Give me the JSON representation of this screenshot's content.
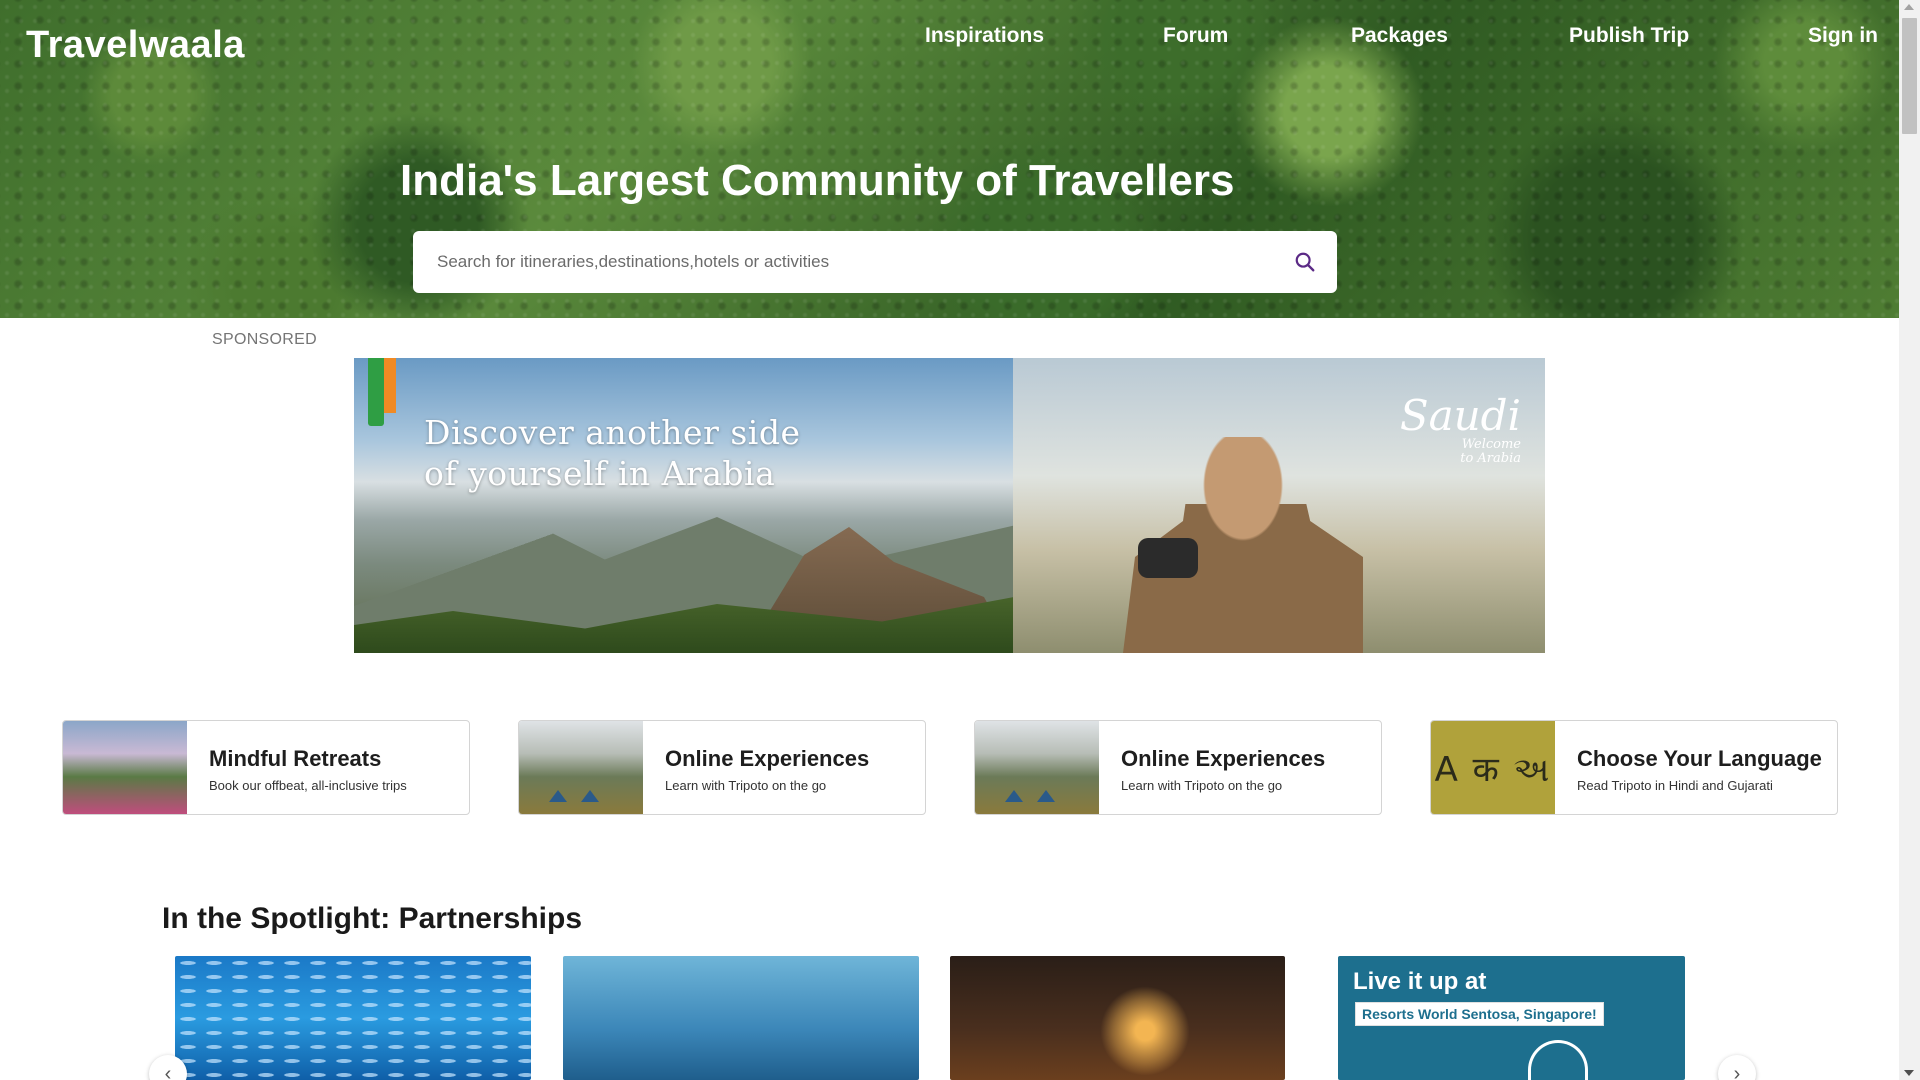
{
  "brand": {
    "name": "Travelwaala"
  },
  "nav": [
    {
      "label": "Inspirations"
    },
    {
      "label": "Forum"
    },
    {
      "label": "Packages"
    },
    {
      "label": "Publish Trip"
    },
    {
      "label": "Sign in"
    }
  ],
  "hero": {
    "title": "India's Largest Community of Travellers",
    "search_placeholder": "Search for itineraries,destinations,hotels or activities",
    "search_value": "",
    "search_icon": "search-icon",
    "search_icon_color": "#5b2a86"
  },
  "sponsored": {
    "label": "SPONSORED",
    "ad_headline_line1": "Discover another side",
    "ad_headline_line2": "of yourself in Arabia",
    "ad_logo_main": "Saudi",
    "ad_logo_sub1": "Welcome",
    "ad_logo_sub2": "to Arabia"
  },
  "quick_links": [
    {
      "title": "Mindful Retreats",
      "subtitle": "Book our offbeat, all-inclusive trips"
    },
    {
      "title": "Online Experiences",
      "subtitle": "Learn with Tripoto on the go"
    },
    {
      "title": "Online Experiences",
      "subtitle": "Learn with Tripoto on the go"
    },
    {
      "title": "Choose Your Language",
      "subtitle": "Read Tripoto in Hindi and Gujarati",
      "thumb_text": "A क અ"
    }
  ],
  "spotlight": {
    "title": "In the Spotlight: Partnerships",
    "card4_title": "Live it up at",
    "card4_tag": "Resorts World Sentosa, Singapore!",
    "prev_icon": "chevron-left-icon",
    "next_icon": "chevron-right-icon"
  },
  "colors": {
    "accent": "#5b2a86",
    "hero_text": "#ffffff",
    "card_border": "#d4d4d4"
  }
}
